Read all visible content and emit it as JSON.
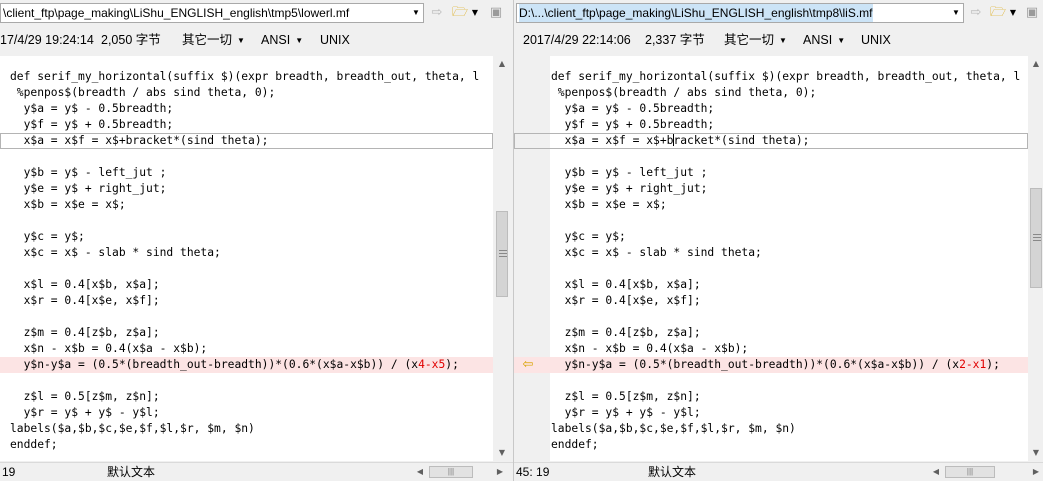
{
  "left_pane": {
    "path": "\\client_ftp\\page_making\\LiShu_ENGLISH_english\\tmp5\\lowerl.mf",
    "info": {
      "datetime": "17/4/29 19:24:14",
      "bytes": "2,050 字节",
      "misc": "其它一切",
      "charset": "ANSI",
      "eol": "UNIX"
    },
    "lines": [
      "def serif_my_horizontal(suffix $)(expr breadth, breadth_out, theta, l",
      " %penpos$(breadth / abs sind theta, 0);",
      "  y$a = y$ - 0.5breadth;",
      "  y$f = y$ + 0.5breadth;",
      "  x$a = x$f = x$+bracket*(sind theta);",
      "",
      "  y$b = y$ - left_jut ;",
      "  y$e = y$ + right_jut;",
      "  x$b = x$e = x$;",
      "",
      "  y$c = y$;",
      "  x$c = x$ - slab * sind theta;",
      "",
      "  x$l = 0.4[x$b, x$a];",
      "  x$r = 0.4[x$e, x$f];",
      "",
      "  z$m = 0.4[z$b, z$a];",
      "  x$n - x$b = 0.4(x$a - x$b);",
      "  y$n-y$a = (0.5*(breadth_out-breadth))*(0.6*(x$a-x$b)) / (x",
      "",
      "  z$l = 0.5[z$m, z$n];",
      "  y$r = y$ + y$ - y$l;",
      "labels($a,$b,$c,$e,$f,$l,$r, $m, $n)",
      "enddef;"
    ],
    "diff_line": {
      "before": "  y$n-y$a = (0.5*(breadth_out-breadth))*(0.6*(x$a-x$b)) / (x",
      "diff": "4-x5",
      "after": ");"
    },
    "status": {
      "position": "19",
      "encoding": "默认文本"
    }
  },
  "right_pane": {
    "path": "D:\\...\\client_ftp\\page_making\\LiShu_ENGLISH_english\\tmp8\\liS.mf",
    "info": {
      "datetime": "2017/4/29 22:14:06",
      "bytes": "2,337 字节",
      "misc": "其它一切",
      "charset": "ANSI",
      "eol": "UNIX"
    },
    "lines": [
      "def serif_my_horizontal(suffix $)(expr breadth, breadth_out, theta, l",
      " %penpos$(breadth / abs sind theta, 0);",
      "  y$a = y$ - 0.5breadth;",
      "  y$f = y$ + 0.5breadth;",
      "  x$a = x$f = x$+bracket*(sind theta);",
      "",
      "  y$b = y$ - left_jut ;",
      "  y$e = y$ + right_jut;",
      "  x$b = x$e = x$;",
      "",
      "  y$c = y$;",
      "  x$c = x$ - slab * sind theta;",
      "",
      "  x$l = 0.4[x$b, x$a];",
      "  x$r = 0.4[x$e, x$f];",
      "",
      "  z$m = 0.4[z$b, z$a];",
      "  x$n - x$b = 0.4(x$a - x$b);",
      "  y$n-y$a = (0.5*(breadth_out-breadth))*(0.6*(x$a-x$b)) / (x",
      "",
      "  z$l = 0.5[z$m, z$n];",
      "  y$r = y$ + y$ - y$l;",
      "labels($a,$b,$c,$e,$f,$l,$r, $m, $n)",
      "enddef;"
    ],
    "diff_line": {
      "before": "  y$n-y$a = (0.5*(breadth_out-breadth))*(0.6*(x$a-x$b)) / (x",
      "diff": "2-x1",
      "after": ");"
    },
    "status": {
      "position": "45: 19",
      "encoding": "默认文本"
    }
  },
  "icons": {
    "copy_arrow": "copy-to-left-arrow-icon",
    "folder": "folder-open-icon",
    "save": "save-icon",
    "dropdown": "chevron-down-icon"
  },
  "colors": {
    "diff_highlight_bg": "#fce4e4",
    "diff_text": "#e00000",
    "selected_path_bg": "#cce4f7",
    "arrow_marker": "#d9a300"
  }
}
